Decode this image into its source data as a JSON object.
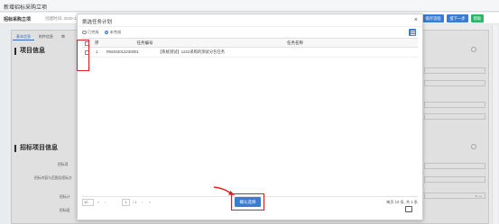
{
  "window_title": "新增招标采购立项",
  "subheader": {
    "title": "招标采购立项",
    "created_label": "创建时间: 2020-12"
  },
  "top_buttons": [
    {
      "label": "保存流程",
      "color": "#3a7bd5"
    },
    {
      "label": "提下一步",
      "color": "#3a7bd5"
    },
    {
      "label": "帮助",
      "color": "#2fb56a"
    }
  ],
  "bg_tabs": [
    "基本信息",
    "附件信息",
    "审"
  ],
  "sections": {
    "project_info": "项目信息",
    "bid_project_info": "招标项目信息"
  },
  "bg_labels": [
    "招标项",
    "招标内容与范围及招标方",
    "招标计",
    "招标组"
  ],
  "bg_right_value": "× —",
  "modal": {
    "title": "挑选任务计划",
    "close": "×",
    "radios": [
      {
        "label": "已完成",
        "checked": false
      },
      {
        "label": "未完成",
        "checked": true
      }
    ],
    "columns": {
      "seq": "序",
      "task_no": "任务编号",
      "task_name": "任务名称"
    },
    "rows": [
      {
        "seq": "1",
        "task_no": "RW202012230001",
        "task_name": "【系统测试】1222采购的测试分包任务"
      }
    ],
    "pager": {
      "page_size": "10",
      "page_input": "1",
      "page_of": "/ 1",
      "first": "«",
      "prev": "‹",
      "next": "›",
      "last": "»",
      "info": "每页 10 条, 共 1 条"
    },
    "confirm_label": "确认选择"
  }
}
